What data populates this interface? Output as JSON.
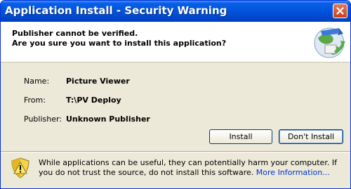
{
  "window": {
    "title": "Application Install - Security Warning"
  },
  "header": {
    "line1": "Publisher cannot be verified.",
    "line2": "Are you sure you want to install this application?"
  },
  "fields": {
    "name_label": "Name:",
    "name_value": "Picture Viewer",
    "from_label": "From:",
    "from_value": "T:\\PV Deploy",
    "publisher_label": "Publisher:",
    "publisher_value": "Unknown Publisher"
  },
  "buttons": {
    "install": "Install",
    "dont_install": "Don't Install"
  },
  "warning": {
    "text": "While applications can be useful, they can potentially harm your computer. If you do not trust the source, do not install this software.",
    "link": "More Information..."
  },
  "colors": {
    "titlebar": "#0255de",
    "dialog_bg": "#ece9d8",
    "link": "#0033cc",
    "close_button": "#c8421c"
  },
  "icons": {
    "header": "globe-install-icon",
    "warning": "shield-warning-icon",
    "close": "close-icon"
  }
}
